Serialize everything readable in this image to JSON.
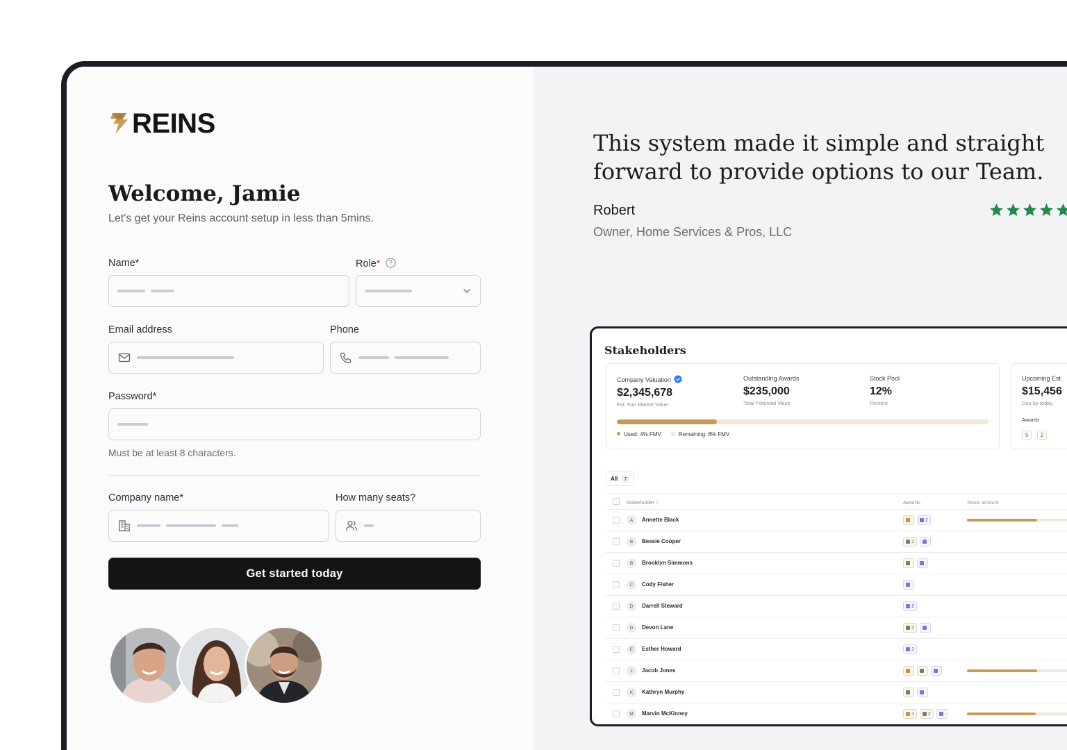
{
  "brand": {
    "name": "REINS",
    "accent": "#c99a57"
  },
  "form": {
    "welcome": "Welcome, Jamie",
    "subtitle": "Let's get your Reins account setup in less than 5mins.",
    "name_label": "Name*",
    "role_label": "Role",
    "role_required": "*",
    "email_label": "Email address",
    "phone_label": "Phone",
    "password_label": "Password*",
    "password_hint": "Must be at least 8 characters.",
    "company_label": "Company name*",
    "seats_label": "How many seats?",
    "cta": "Get started today"
  },
  "testimonial": {
    "quote": "This system made it simple and straight forward to provide options to our Team.",
    "author": "Robert",
    "role": "Owner, Home Services & Pros, LLC",
    "rating": 5,
    "star_color": "#1f8a4c"
  },
  "dashboard": {
    "title": "Stakeholders",
    "metrics": [
      {
        "label": "Company Valuation",
        "value": "$2,345,678",
        "sub": "Est. Fair Market Value"
      },
      {
        "label": "Outstanding Awards",
        "value": "$235,000",
        "sub": "Total Potential Value"
      },
      {
        "label": "Stock Pool",
        "value": "12%",
        "sub": "Percent"
      }
    ],
    "pool_used_fraction": 0.27,
    "legend_used": "Used: 4% FMV",
    "legend_remaining": "Remaining: 8% FMV",
    "upcoming": {
      "label": "Upcoming Est",
      "value": "$15,456",
      "sub": "Due by today",
      "awards_label": "Awards",
      "chips": [
        "5",
        "2"
      ]
    },
    "filter": {
      "label": "All",
      "count": "7"
    },
    "columns": {
      "stakeholder": "Stakeholder",
      "awards": "Awards",
      "stock": "Stock amount"
    },
    "rows": [
      {
        "initial": "A",
        "name": "Annette Black",
        "awards": [
          {
            "type": "option",
            "count": ""
          },
          {
            "type": "share",
            "count": "2"
          }
        ],
        "stock": 0.44
      },
      {
        "initial": "B",
        "name": "Bessie Cooper",
        "awards": [
          {
            "type": "rsu",
            "count": "2"
          },
          {
            "type": "share",
            "count": ""
          }
        ],
        "stock": null
      },
      {
        "initial": "B",
        "name": "Brooklyn Simmons",
        "awards": [
          {
            "type": "rsu",
            "count": ""
          },
          {
            "type": "share",
            "count": ""
          }
        ],
        "stock": null
      },
      {
        "initial": "C",
        "name": "Cody Fisher",
        "awards": [
          {
            "type": "share",
            "count": ""
          }
        ],
        "stock": null
      },
      {
        "initial": "D",
        "name": "Darrell Steward",
        "awards": [
          {
            "type": "share",
            "count": "2"
          }
        ],
        "stock": null
      },
      {
        "initial": "D",
        "name": "Devon Lane",
        "awards": [
          {
            "type": "rsu",
            "count": "2"
          },
          {
            "type": "share",
            "count": ""
          }
        ],
        "stock": null
      },
      {
        "initial": "E",
        "name": "Esther Howard",
        "awards": [
          {
            "type": "share",
            "count": "2"
          }
        ],
        "stock": null
      },
      {
        "initial": "J",
        "name": "Jacob Jones",
        "awards": [
          {
            "type": "option",
            "count": ""
          },
          {
            "type": "rsu",
            "count": ""
          },
          {
            "type": "share",
            "count": ""
          }
        ],
        "stock": 0.44
      },
      {
        "initial": "K",
        "name": "Kathryn Murphy",
        "awards": [
          {
            "type": "rsu",
            "count": ""
          },
          {
            "type": "share",
            "count": ""
          }
        ],
        "stock": null
      },
      {
        "initial": "M",
        "name": "Marvin McKinney",
        "awards": [
          {
            "type": "option",
            "count": "3"
          },
          {
            "type": "rsu",
            "count": "2"
          },
          {
            "type": "share",
            "count": ""
          }
        ],
        "stock": 0.43
      }
    ]
  }
}
